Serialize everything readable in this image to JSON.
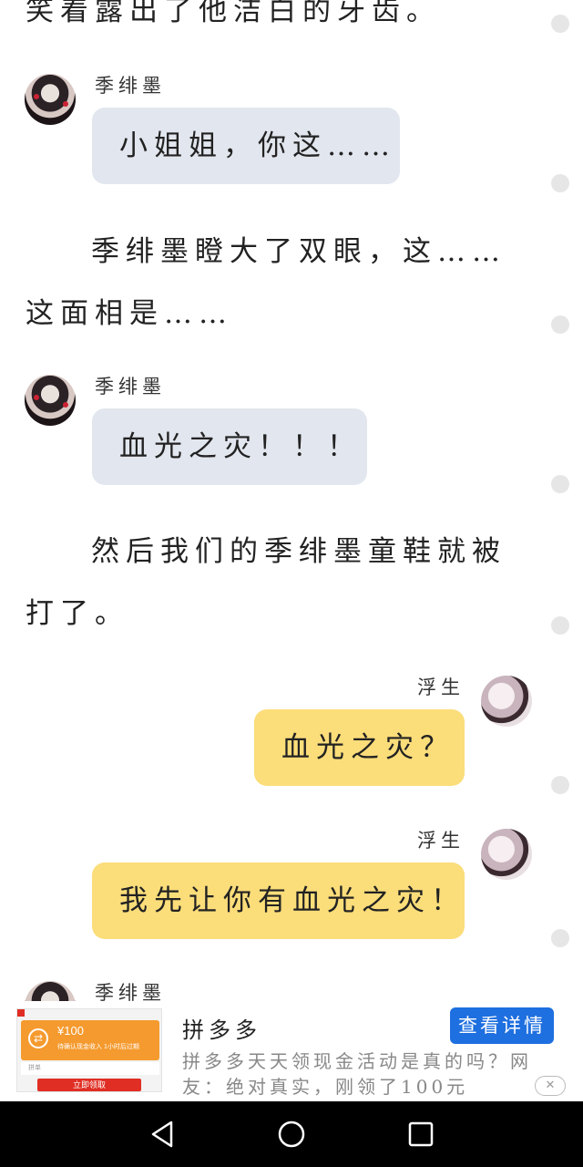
{
  "story": {
    "top_line": "笑着露出了他洁白的牙齿。",
    "para1": "季绯墨瞪大了双眼，这……这面相是……",
    "para2": "然后我们的季绯墨童鞋就被打了。"
  },
  "messages": [
    {
      "sender": "季绯墨",
      "text": "小姐姐，你这……"
    },
    {
      "sender": "季绯墨",
      "text": "血光之灾！！！"
    },
    {
      "sender": "浮生",
      "text": "血光之灾？"
    },
    {
      "sender": "浮生",
      "text": "我先让你有血光之灾！"
    },
    {
      "sender": "季绯墨"
    }
  ],
  "ad": {
    "title": "拼多多",
    "cta": "查看详情",
    "description": "拼多多天天领现金活动是真的吗？网友：绝对真实，刚领了100元",
    "thumb_amount": "¥100",
    "thumb_sub": "待确认现金收入 1小时后过期",
    "thumb_field": "拼单",
    "thumb_button": "立即领取",
    "close_icon": "close-icon"
  },
  "nav": {
    "back_icon": "triangle-back-icon",
    "home_icon": "circle-home-icon",
    "recents_icon": "square-recents-icon"
  },
  "colors": {
    "left_bubble": "#e2e6ee",
    "right_bubble": "#fbdd7a",
    "ad_cta": "#1e6fe0",
    "navbar": "#000000"
  }
}
